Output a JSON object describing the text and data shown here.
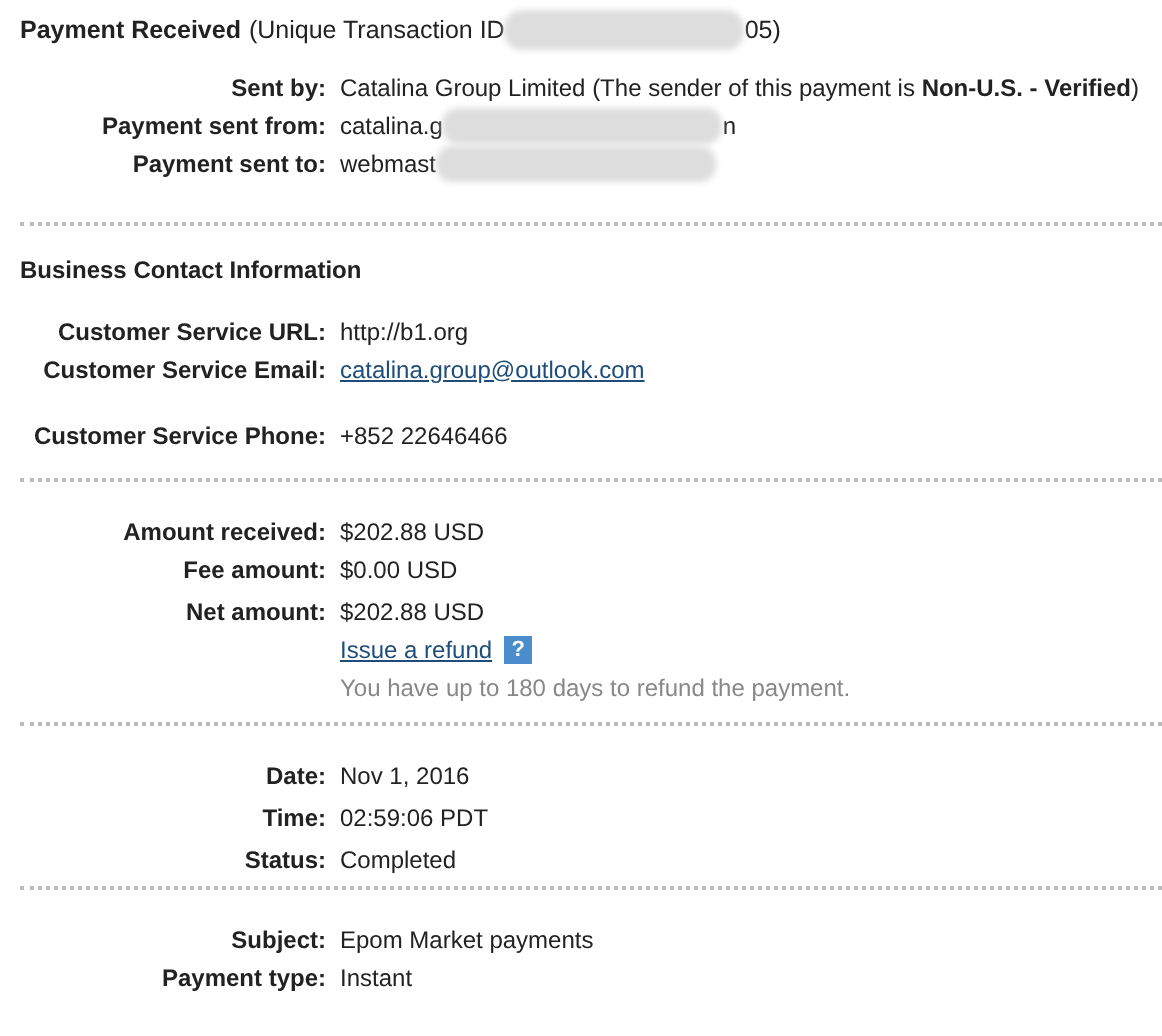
{
  "heading": {
    "title": "Payment Received",
    "parts": [
      {
        "kind": "text",
        "text": "(Unique Transaction ID"
      },
      {
        "kind": "redacted"
      },
      {
        "kind": "text",
        "text": "05)"
      }
    ]
  },
  "sections": [
    {
      "groups": [
        [
          {
            "label": "Sent by:",
            "kind": "text",
            "parts": [
              {
                "kind": "text",
                "text": "Catalina Group Limited (The sender of this payment is **Non-U.S. - Verified**)"
              }
            ]
          },
          {
            "label": "Payment sent from:",
            "kind": "text",
            "parts": [
              {
                "kind": "text",
                "text": "catalina.g"
              },
              {
                "kind": "redacted"
              },
              {
                "kind": "text",
                "text": "n"
              }
            ]
          },
          {
            "label": "Payment sent to:",
            "kind": "text",
            "parts": [
              {
                "kind": "text",
                "text": "webmast"
              },
              {
                "kind": "redacted"
              }
            ]
          }
        ]
      ]
    },
    {
      "title": "Business Contact Information",
      "groups": [
        [
          {
            "label": "Customer Service URL:",
            "kind": "text",
            "parts": [
              {
                "kind": "text",
                "text": "http://b1.org"
              }
            ]
          },
          {
            "label": "Customer Service Email:",
            "kind": "link",
            "parts": [
              {
                "kind": "text",
                "text": "catalina.group@outlook.com"
              }
            ]
          }
        ],
        [
          {
            "label": "Customer Service Phone:",
            "kind": "text",
            "parts": [
              {
                "kind": "text",
                "text": "+852 22646466"
              }
            ]
          }
        ]
      ]
    },
    {
      "groups": [
        [
          {
            "label": "Amount received:",
            "kind": "text",
            "parts": [
              {
                "kind": "text",
                "text": "$202.88 USD"
              }
            ]
          },
          {
            "label": "Fee amount:",
            "kind": "text",
            "parts": [
              {
                "kind": "text",
                "text": "$0.00 USD"
              }
            ]
          }
        ],
        [
          {
            "label": "Net amount:",
            "kind": "text",
            "parts": [
              {
                "kind": "text",
                "text": "$202.88 USD"
              }
            ]
          },
          {
            "kind": "link",
            "help": "?",
            "parts": [
              {
                "kind": "text",
                "text": "Issue a refund"
              }
            ]
          },
          {
            "kind": "note",
            "parts": [
              {
                "kind": "text",
                "text": "You have up to 180 days to refund the payment."
              }
            ]
          }
        ]
      ]
    },
    {
      "groups": [
        [
          {
            "label": "Date:",
            "kind": "text",
            "parts": [
              {
                "kind": "text",
                "text": "Nov 1, 2016"
              }
            ]
          }
        ],
        [
          {
            "label": "Time:",
            "kind": "text",
            "parts": [
              {
                "kind": "text",
                "text": "02:59:06 PDT"
              }
            ]
          }
        ],
        [
          {
            "label": "Status:",
            "kind": "text",
            "parts": [
              {
                "kind": "text",
                "text": "Completed"
              }
            ]
          }
        ]
      ]
    },
    {
      "groups": [
        [
          {
            "label": "Subject:",
            "kind": "text",
            "parts": [
              {
                "kind": "text",
                "text": "Epom Market payments"
              }
            ]
          },
          {
            "label": "Payment type:",
            "kind": "text",
            "parts": [
              {
                "kind": "text",
                "text": "Instant"
              }
            ]
          }
        ]
      ]
    }
  ]
}
